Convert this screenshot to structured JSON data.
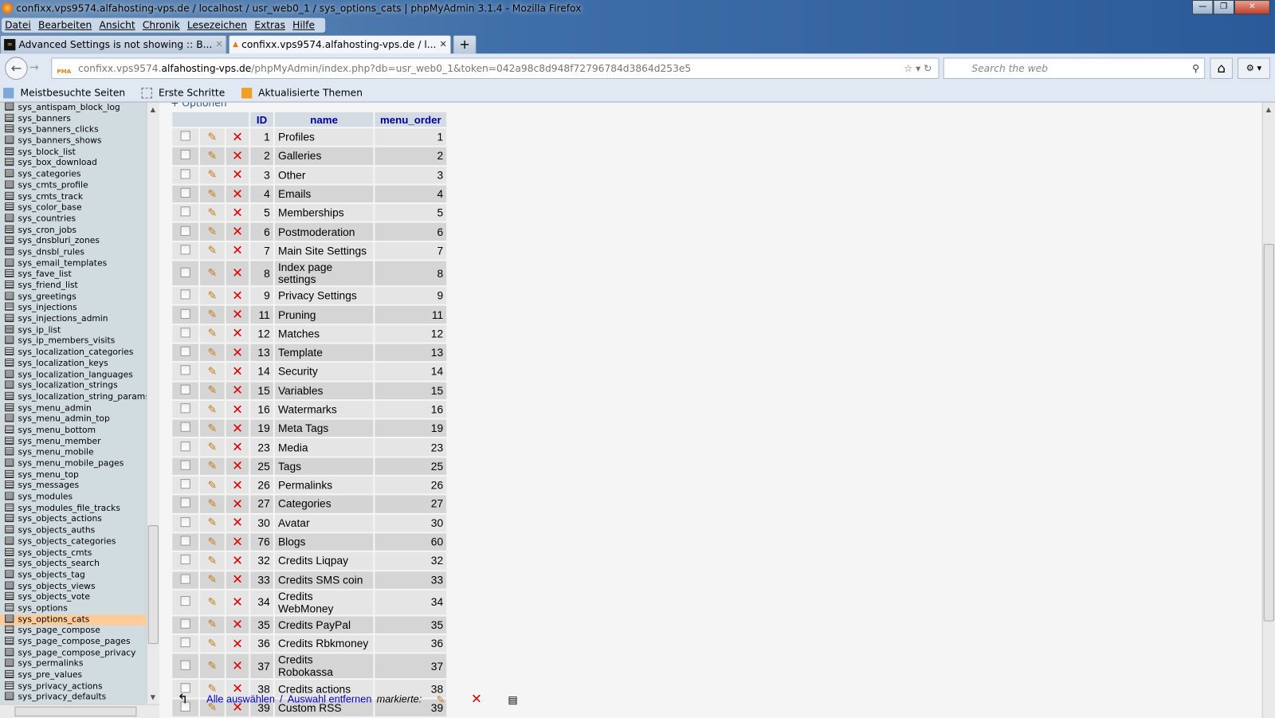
{
  "window": {
    "title": "confixx.vps9574.alfahosting-vps.de / localhost / usr_web0_1 / sys_options_cats | phpMyAdmin 3.1.4 - Mozilla Firefox"
  },
  "menu": [
    "Datei",
    "Bearbeiten",
    "Ansicht",
    "Chronik",
    "Lesezeichen",
    "Extras",
    "Hilfe"
  ],
  "tabs": [
    {
      "label": "Advanced Settings is not showing :: B..."
    },
    {
      "label": "confixx.vps9574.alfahosting-vps.de / l..."
    }
  ],
  "nav": {
    "url_pre": "confixx.vps9574.",
    "url_domain": "alfahosting-vps.de",
    "url_post": "/phpMyAdmin/index.php?db=usr_web0_1&token=042a98c8d948f72796784d3864d253e5",
    "search_placeholder": "Search the web",
    "pma": "PMA"
  },
  "bookmarks": [
    "Meistbesuchte Seiten",
    "Erste Schritte",
    "Aktualisierte Themen"
  ],
  "sidebar": {
    "selected": "sys_options_cats",
    "items": [
      "sys_antispam_block_log",
      "sys_banners",
      "sys_banners_clicks",
      "sys_banners_shows",
      "sys_block_list",
      "sys_box_download",
      "sys_categories",
      "sys_cmts_profile",
      "sys_cmts_track",
      "sys_color_base",
      "sys_countries",
      "sys_cron_jobs",
      "sys_dnsbluri_zones",
      "sys_dnsbl_rules",
      "sys_email_templates",
      "sys_fave_list",
      "sys_friend_list",
      "sys_greetings",
      "sys_injections",
      "sys_injections_admin",
      "sys_ip_list",
      "sys_ip_members_visits",
      "sys_localization_categories",
      "sys_localization_keys",
      "sys_localization_languages",
      "sys_localization_strings",
      "sys_localization_string_params",
      "sys_menu_admin",
      "sys_menu_admin_top",
      "sys_menu_bottom",
      "sys_menu_member",
      "sys_menu_mobile",
      "sys_menu_mobile_pages",
      "sys_menu_top",
      "sys_messages",
      "sys_modules",
      "sys_modules_file_tracks",
      "sys_objects_actions",
      "sys_objects_auths",
      "sys_objects_categories",
      "sys_objects_cmts",
      "sys_objects_search",
      "sys_objects_tag",
      "sys_objects_views",
      "sys_objects_vote",
      "sys_options",
      "sys_options_cats",
      "sys_page_compose",
      "sys_page_compose_pages",
      "sys_page_compose_privacy",
      "sys_permalinks",
      "sys_pre_values",
      "sys_privacy_actions",
      "sys_privacy_defaults"
    ]
  },
  "main": {
    "options_link": "+ Optionen",
    "columns": [
      "ID",
      "name",
      "menu_order"
    ],
    "rows": [
      [
        1,
        "Profiles",
        1
      ],
      [
        2,
        "Galleries",
        2
      ],
      [
        3,
        "Other",
        3
      ],
      [
        4,
        "Emails",
        4
      ],
      [
        5,
        "Memberships",
        5
      ],
      [
        6,
        "Postmoderation",
        6
      ],
      [
        7,
        "Main Site Settings",
        7
      ],
      [
        8,
        "Index page settings",
        8
      ],
      [
        9,
        "Privacy Settings",
        9
      ],
      [
        11,
        "Pruning",
        11
      ],
      [
        12,
        "Matches",
        12
      ],
      [
        13,
        "Template",
        13
      ],
      [
        14,
        "Security",
        14
      ],
      [
        15,
        "Variables",
        15
      ],
      [
        16,
        "Watermarks",
        16
      ],
      [
        19,
        "Meta Tags",
        19
      ],
      [
        23,
        "Media",
        23
      ],
      [
        25,
        "Tags",
        25
      ],
      [
        26,
        "Permalinks",
        26
      ],
      [
        27,
        "Categories",
        27
      ],
      [
        30,
        "Avatar",
        30
      ],
      [
        76,
        "Blogs",
        60
      ],
      [
        32,
        "Credits Liqpay",
        32
      ],
      [
        33,
        "Credits SMS coin",
        33
      ],
      [
        34,
        "Credits WebMoney",
        34
      ],
      [
        35,
        "Credits PayPal",
        35
      ],
      [
        36,
        "Credits Rbkmoney",
        36
      ],
      [
        37,
        "Credits Robokassa",
        37
      ],
      [
        38,
        "Credits actions",
        38
      ],
      [
        39,
        "Custom RSS",
        39
      ]
    ],
    "footer": {
      "select_all": "Alle auswählen",
      "separator": "/",
      "deselect": "Auswahl entfernen",
      "marked": "markierte:"
    }
  }
}
